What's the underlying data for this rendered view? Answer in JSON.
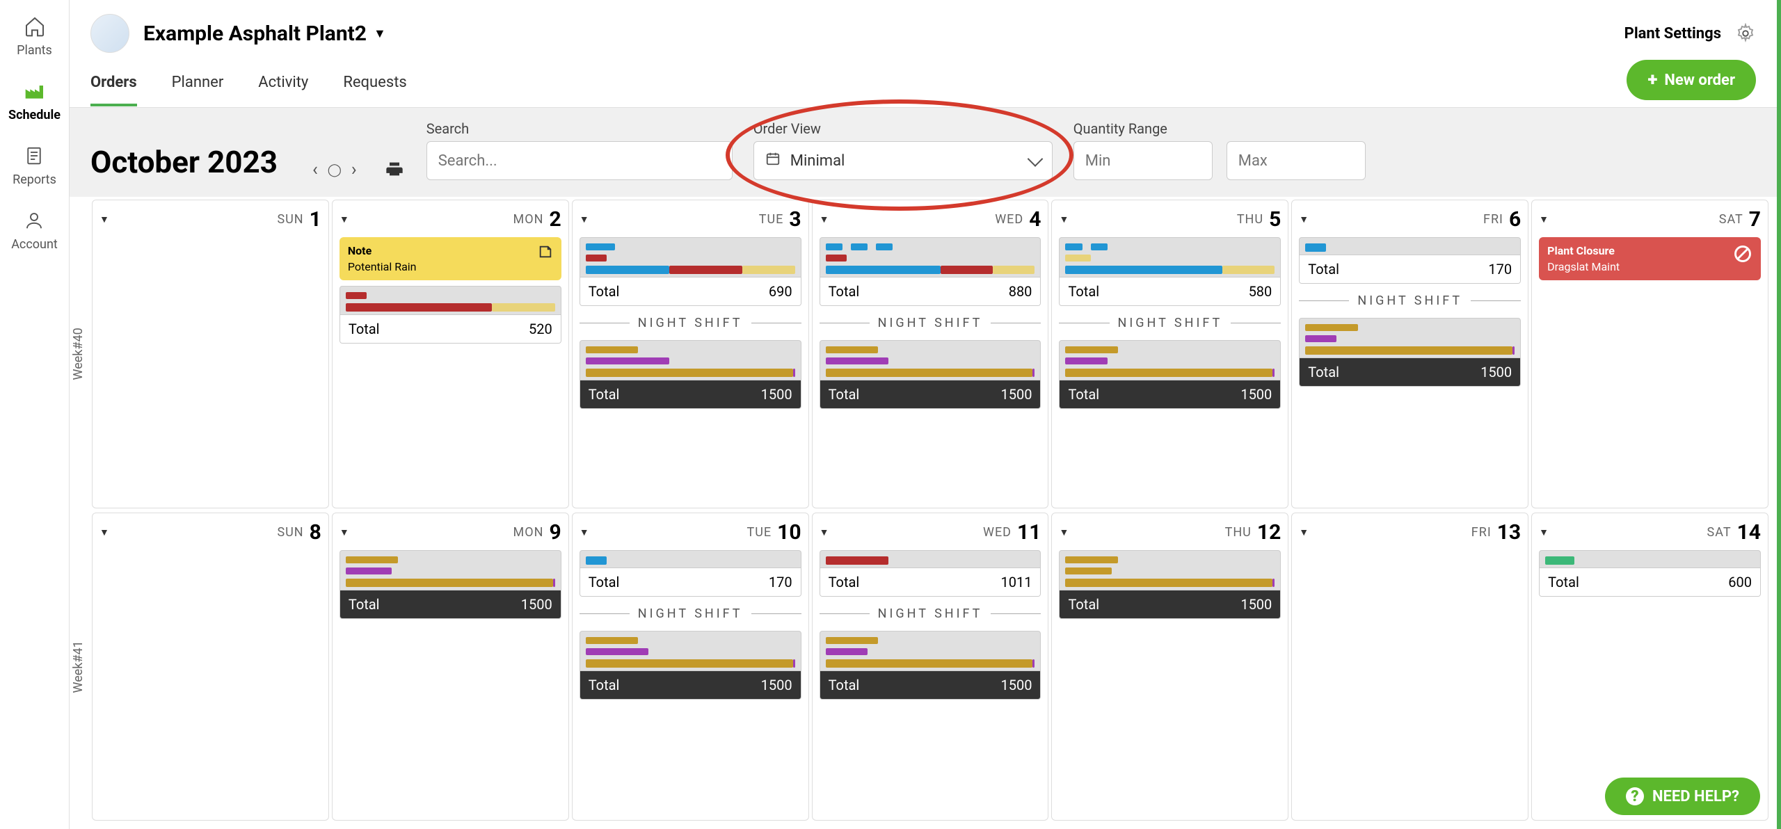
{
  "sidebar": {
    "items": [
      {
        "label": "Plants",
        "icon": "home"
      },
      {
        "label": "Schedule",
        "icon": "factory"
      },
      {
        "label": "Reports",
        "icon": "document"
      },
      {
        "label": "Account",
        "icon": "user"
      }
    ]
  },
  "topbar": {
    "plant_name": "Example Asphalt Plant2",
    "settings_label": "Plant Settings"
  },
  "tabs": {
    "items": [
      {
        "label": "Orders"
      },
      {
        "label": "Planner"
      },
      {
        "label": "Activity"
      },
      {
        "label": "Requests"
      }
    ],
    "new_order_label": "New order"
  },
  "filters": {
    "month_label": "October 2023",
    "search_label": "Search",
    "search_placeholder": "Search...",
    "order_view_label": "Order View",
    "order_view_value": "Minimal",
    "quantity_range_label": "Quantity Range",
    "min_placeholder": "Min",
    "max_placeholder": "Max"
  },
  "calendar": {
    "total_label": "Total",
    "night_shift_label": "NIGHT SHIFT",
    "weeks": [
      {
        "label": "Week#40",
        "days": [
          {
            "dow": "SUN",
            "num": "1"
          },
          {
            "dow": "MON",
            "num": "2",
            "note": {
              "title": "Note",
              "body": "Potential Rain"
            },
            "day_total": 520
          },
          {
            "dow": "TUE",
            "num": "3",
            "day_total": 690,
            "night_total": 1500
          },
          {
            "dow": "WED",
            "num": "4",
            "day_total": 880,
            "night_total": 1500
          },
          {
            "dow": "THU",
            "num": "5",
            "day_total": 580,
            "night_total": 1500
          },
          {
            "dow": "FRI",
            "num": "6",
            "day_total": 170,
            "night_total": 1500
          },
          {
            "dow": "SAT",
            "num": "7",
            "closure": {
              "title": "Plant Closure",
              "body": "Dragslat Maint"
            }
          }
        ]
      },
      {
        "label": "Week#41",
        "days": [
          {
            "dow": "SUN",
            "num": "8"
          },
          {
            "dow": "MON",
            "num": "9",
            "night_total": 1500,
            "night_only": true
          },
          {
            "dow": "TUE",
            "num": "10",
            "day_total": 170,
            "night_total": 1500
          },
          {
            "dow": "WED",
            "num": "11",
            "day_total": 1011,
            "night_total": 1500
          },
          {
            "dow": "THU",
            "num": "12",
            "night_total": 1500,
            "night_only": true
          },
          {
            "dow": "FRI",
            "num": "13"
          },
          {
            "dow": "SAT",
            "num": "14",
            "day_total": 600
          }
        ]
      }
    ]
  },
  "help_button": "NEED HELP?"
}
